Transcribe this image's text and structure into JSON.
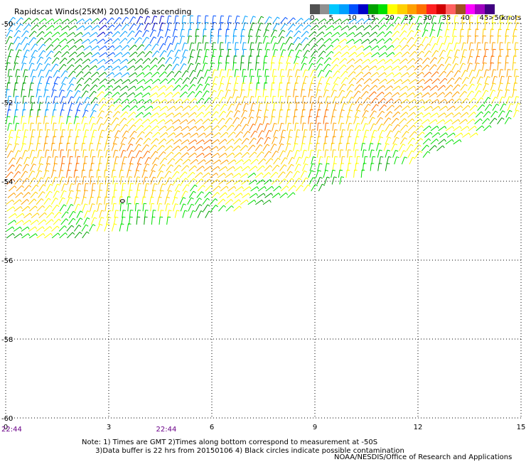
{
  "title": "Rapidscat Winds(25KM) 20150106 ascending",
  "colorbar": {
    "colors": [
      "#505050",
      "#909090",
      "#00c8ff",
      "#00a0ff",
      "#0050ff",
      "#0000c8",
      "#00a000",
      "#00e000",
      "#ffff00",
      "#ffd000",
      "#ffa000",
      "#ff7000",
      "#ff2020",
      "#d00000",
      "#ff6060",
      "#a05020",
      "#ff00ff",
      "#a000c0",
      "#400080"
    ],
    "labels": [
      "0",
      "5",
      "10",
      "15",
      "20",
      "25",
      "30",
      "35",
      "40",
      "45",
      ">50"
    ],
    "unit": "knots"
  },
  "map": {
    "lon_labels": [
      "0",
      "3",
      "6",
      "9",
      "12",
      "15"
    ],
    "lat_labels": [
      "-50",
      "-52",
      "-54",
      "-56",
      "-58",
      "-60"
    ],
    "lon_range": [
      0,
      15
    ],
    "lat_range": [
      -60,
      -50
    ],
    "grid": "dotted",
    "swath_south_edge_lat": [
      [
        0,
        -55.6
      ],
      [
        3,
        -55.4
      ],
      [
        6,
        -54.9
      ],
      [
        8,
        -54.5
      ],
      [
        9,
        -54.3
      ],
      [
        12,
        -53.5
      ],
      [
        15,
        -52.4
      ]
    ]
  },
  "times": [
    {
      "lon": 0,
      "label": "22:44"
    },
    {
      "lon": 4.5,
      "label": "22:44"
    }
  ],
  "note": "Note: 1) Times are GMT 2)Times along bottom correspond to measurement at -50S\n      3)Data buffer is 22 hrs from 20150106 4) Black circles indicate possible contamination",
  "credit": "NOAA/NESDIS/Office of Research and Applications"
}
